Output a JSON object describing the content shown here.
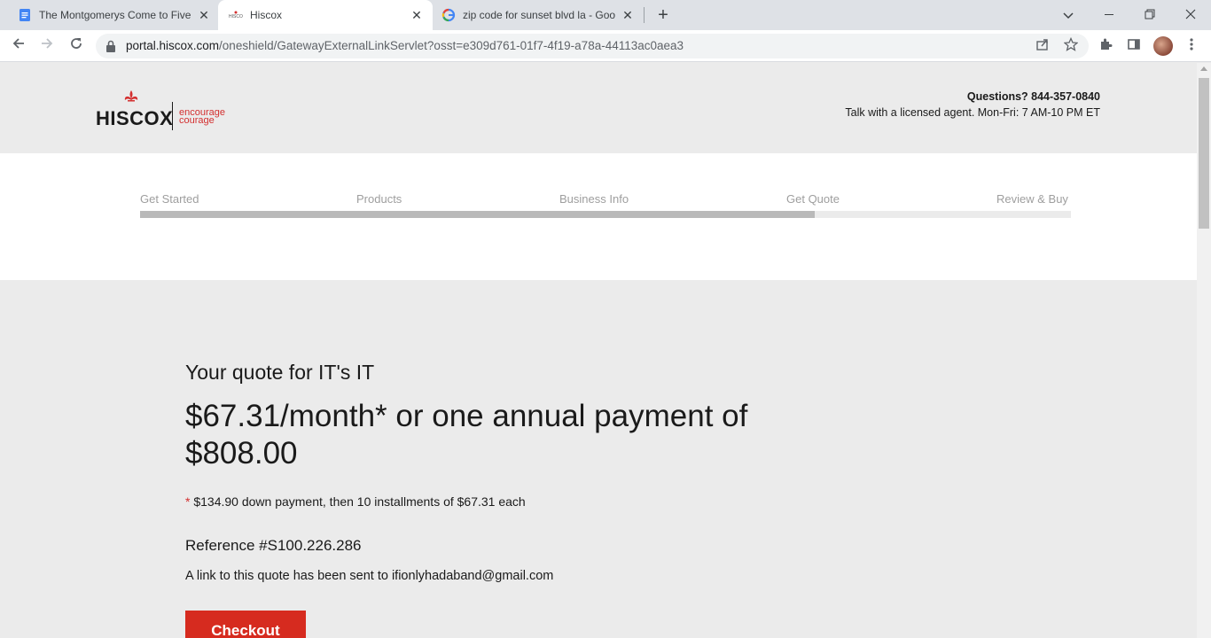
{
  "browser": {
    "tabs": [
      {
        "title": "The Montgomerys Come to Five",
        "icon": "google-docs-icon",
        "active": false
      },
      {
        "title": "Hiscox",
        "icon": "hiscox-favicon",
        "active": true
      },
      {
        "title": "zip code for sunset blvd la - Goo",
        "icon": "google-icon",
        "active": false
      }
    ],
    "new_tab_symbol": "+",
    "address": {
      "host": "portal.hiscox.com",
      "path": "/oneshield/GatewayExternalLinkServlet?osst=e309d761-01f7-4f19-a78a-44113ac0aea3"
    }
  },
  "header": {
    "logo_word": "HISCOX",
    "logo_tag_line1": "encourage",
    "logo_tag_line2": "courage",
    "questions": "Questions?  844-357-0840",
    "talk": "Talk with a licensed agent.  Mon-Fri: 7 AM-10 PM ET"
  },
  "steps": {
    "items": [
      "Get Started",
      "Products",
      "Business Info",
      "Get Quote",
      "Review & Buy"
    ],
    "progress_fraction": 0.725
  },
  "quote": {
    "heading": "Your quote for IT's IT",
    "price": "$67.31/month* or one annual payment of $808.00",
    "note_star": "*",
    "note": " $134.90 down payment, then 10 installments of $67.31 each",
    "reference": "Reference #S100.226.286",
    "sent": "A link to this quote has been sent to ifionlyhadaband@gmail.com",
    "checkout_label": "Checkout"
  },
  "colors": {
    "brand_red": "#d62b1f",
    "page_bg": "#ebebeb",
    "progress_fill": "#b9b9b9"
  }
}
